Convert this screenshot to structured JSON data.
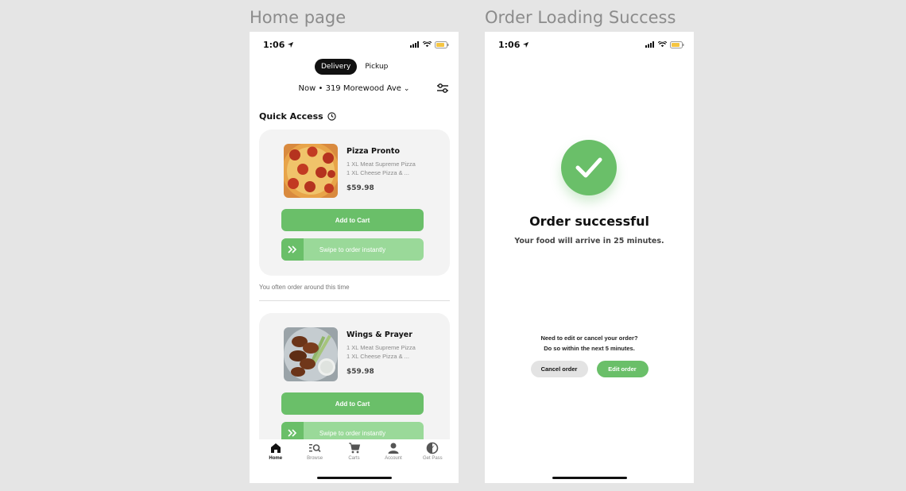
{
  "frames": {
    "home_title": "Home page",
    "success_title": "Order Loading Success"
  },
  "status_bar": {
    "time": "1:06"
  },
  "home": {
    "toggle": {
      "delivery": "Delivery",
      "pickup": "Pickup"
    },
    "address": "Now • 319 Morewood Ave",
    "section_title": "Quick Access",
    "cards": [
      {
        "name": "Pizza Pronto",
        "line1": "1 XL Meat Supreme Pizza",
        "line2": "1 XL Cheese Pizza & ...",
        "price": "$59.98",
        "add_label": "Add to Cart",
        "swipe_label": "Swipe to order instantly"
      },
      {
        "name": "Wings & Prayer",
        "line1": "1 XL Meat Supreme Pizza",
        "line2": "1 XL Cheese Pizza & ...",
        "price": "$59.98",
        "add_label": "Add to Cart",
        "swipe_label": "Swipe to order instantly"
      }
    ],
    "hint": "You often order around this time",
    "tabs": [
      {
        "label": "Home",
        "icon": "home-icon"
      },
      {
        "label": "Browse",
        "icon": "browse-icon"
      },
      {
        "label": "Carts",
        "icon": "cart-icon"
      },
      {
        "label": "Account",
        "icon": "account-icon"
      },
      {
        "label": "Get Pass",
        "icon": "pass-icon"
      }
    ]
  },
  "success": {
    "title": "Order successful",
    "subtitle": "Your food will arrive in 25 minutes.",
    "edit_line1": "Need to edit or cancel your order?",
    "edit_line2": "Do so within the next 5 minutes.",
    "cancel_label": "Cancel order",
    "edit_label": "Edit order"
  },
  "colors": {
    "accent": "#6abf69",
    "accent_light": "#9ad999",
    "card_bg": "#f3f3f3",
    "battery": "#f5c542"
  }
}
